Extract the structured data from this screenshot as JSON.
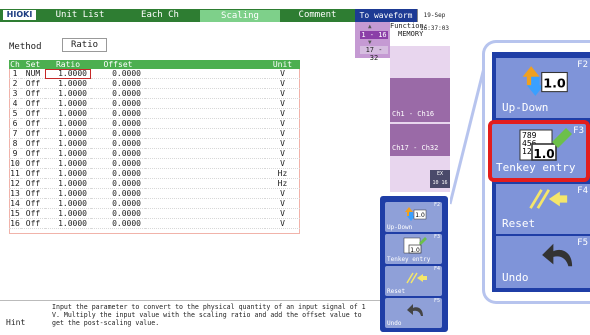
{
  "header": {
    "logo": "HIOKI",
    "tabs": [
      {
        "label": "Unit List",
        "active": false
      },
      {
        "label": "Each Ch",
        "active": false
      },
      {
        "label": "Scaling",
        "active": true
      },
      {
        "label": "Comment",
        "active": false
      }
    ],
    "to_waveform": "To waveform",
    "datetime": "19-Sep 16:37:03"
  },
  "ch_selector": {
    "range1": "1 - 16",
    "range2": "17 - 32"
  },
  "function": {
    "label": "Function:",
    "value": "MEMORY"
  },
  "method": {
    "label": "Method",
    "value": "Ratio"
  },
  "table": {
    "headers": [
      "Ch",
      "Set",
      "Ratio",
      "Offset",
      "",
      "Unit"
    ],
    "rows": [
      {
        "ch": "1",
        "set": "NUM",
        "ratio": "1.0000",
        "offset": "0.0000",
        "unit": "V"
      },
      {
        "ch": "2",
        "set": "Off",
        "ratio": "1.0000",
        "offset": "0.0000",
        "unit": "V"
      },
      {
        "ch": "3",
        "set": "Off",
        "ratio": "1.0000",
        "offset": "0.0000",
        "unit": "V"
      },
      {
        "ch": "4",
        "set": "Off",
        "ratio": "1.0000",
        "offset": "0.0000",
        "unit": "V"
      },
      {
        "ch": "5",
        "set": "Off",
        "ratio": "1.0000",
        "offset": "0.0000",
        "unit": "V"
      },
      {
        "ch": "6",
        "set": "Off",
        "ratio": "1.0000",
        "offset": "0.0000",
        "unit": "V"
      },
      {
        "ch": "7",
        "set": "Off",
        "ratio": "1.0000",
        "offset": "0.0000",
        "unit": "V"
      },
      {
        "ch": "8",
        "set": "Off",
        "ratio": "1.0000",
        "offset": "0.0000",
        "unit": "V"
      },
      {
        "ch": "9",
        "set": "Off",
        "ratio": "1.0000",
        "offset": "0.0000",
        "unit": "V"
      },
      {
        "ch": "10",
        "set": "Off",
        "ratio": "1.0000",
        "offset": "0.0000",
        "unit": "V"
      },
      {
        "ch": "11",
        "set": "Off",
        "ratio": "1.0000",
        "offset": "0.0000",
        "unit": "Hz"
      },
      {
        "ch": "12",
        "set": "Off",
        "ratio": "1.0000",
        "offset": "0.0000",
        "unit": "Hz"
      },
      {
        "ch": "13",
        "set": "Off",
        "ratio": "1.0000",
        "offset": "0.0000",
        "unit": "V"
      },
      {
        "ch": "14",
        "set": "Off",
        "ratio": "1.0000",
        "offset": "0.0000",
        "unit": "V"
      },
      {
        "ch": "15",
        "set": "Off",
        "ratio": "1.0000",
        "offset": "0.0000",
        "unit": "V"
      },
      {
        "ch": "16",
        "set": "Off",
        "ratio": "1.0000",
        "offset": "0.0000",
        "unit": "V"
      }
    ]
  },
  "side_strip": {
    "ch1_16": "Ch1 - Ch16",
    "ch17_32": "Ch17 - Ch32",
    "icon_top": "EX",
    "icon_bottom": "10 16"
  },
  "function_buttons": [
    {
      "label": "Up-Down",
      "key": "F2",
      "icon": "up-down-icon"
    },
    {
      "label": "Tenkey entry",
      "key": "F3",
      "icon": "tenkey-icon",
      "icon_digits": "789 456 123",
      "icon_value": "1.0"
    },
    {
      "label": "Reset",
      "key": "F4",
      "icon": "reset-arrow-icon"
    },
    {
      "label": "Undo",
      "key": "F5",
      "icon": "undo-arrow-icon"
    }
  ],
  "up_down_icon_value": "1.0",
  "hint": {
    "label": "Hint",
    "text": "Input the parameter to convert to the physical quantity of an input signal of 1 V. Multiply the input value with the scaling ratio and add the offset value to get the post-scaling value."
  },
  "colors": {
    "tab_green": "#2e7d32",
    "active_tab": "#7ed08a",
    "panel_blue": "#1f3ea6",
    "button_blue": "#7f94d9",
    "highlight_red": "#e21d1d",
    "purple": "#9a6aa7"
  }
}
